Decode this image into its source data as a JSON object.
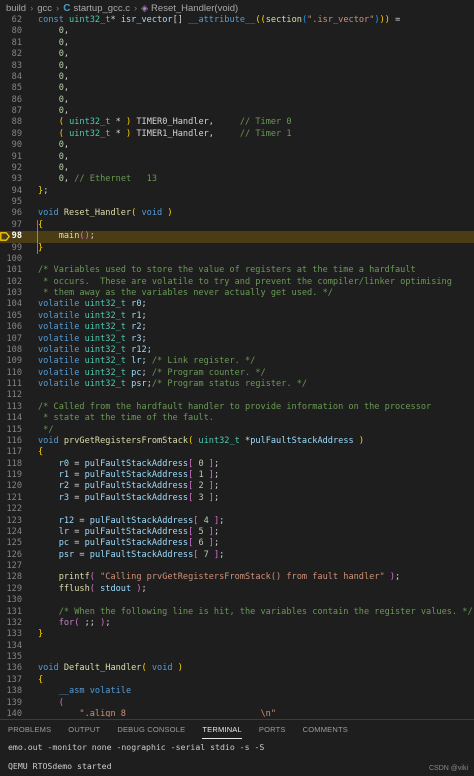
{
  "breadcrumb": {
    "items": [
      "build",
      "gcc",
      "startup_gcc.c",
      "Reset_Handler(void)"
    ]
  },
  "editor": {
    "current_line": 98,
    "lines": [
      {
        "n": "62",
        "t": [
          [
            "kw",
            "const "
          ],
          [
            "ty",
            "uint32_t"
          ],
          [
            "pl",
            "* "
          ],
          [
            "var",
            "isr_vector"
          ],
          [
            "pl",
            "[] "
          ],
          [
            "kw",
            "__attribute__"
          ],
          [
            "par",
            "(("
          ],
          [
            "fn",
            "section"
          ],
          [
            "par3",
            "("
          ],
          [
            "str",
            "\".isr_vector\""
          ],
          [
            "par3",
            ")"
          ],
          [
            "par",
            "))"
          ],
          [
            "pl",
            " ="
          ]
        ]
      },
      {
        "n": "80",
        "t": [
          [
            "pl",
            "    "
          ],
          [
            "num",
            "0"
          ],
          [
            "pl",
            ","
          ]
        ]
      },
      {
        "n": "81",
        "t": [
          [
            "pl",
            "    "
          ],
          [
            "num",
            "0"
          ],
          [
            "pl",
            ","
          ]
        ]
      },
      {
        "n": "82",
        "t": [
          [
            "pl",
            "    "
          ],
          [
            "num",
            "0"
          ],
          [
            "pl",
            ","
          ]
        ]
      },
      {
        "n": "83",
        "t": [
          [
            "pl",
            "    "
          ],
          [
            "num",
            "0"
          ],
          [
            "pl",
            ","
          ]
        ]
      },
      {
        "n": "84",
        "t": [
          [
            "pl",
            "    "
          ],
          [
            "num",
            "0"
          ],
          [
            "pl",
            ","
          ]
        ]
      },
      {
        "n": "85",
        "t": [
          [
            "pl",
            "    "
          ],
          [
            "num",
            "0"
          ],
          [
            "pl",
            ","
          ]
        ]
      },
      {
        "n": "86",
        "t": [
          [
            "pl",
            "    "
          ],
          [
            "num",
            "0"
          ],
          [
            "pl",
            ","
          ]
        ]
      },
      {
        "n": "87",
        "t": [
          [
            "pl",
            "    "
          ],
          [
            "num",
            "0"
          ],
          [
            "pl",
            ","
          ]
        ]
      },
      {
        "n": "88",
        "t": [
          [
            "pl",
            "    "
          ],
          [
            "par",
            "( "
          ],
          [
            "ty",
            "uint32_t"
          ],
          [
            "pl",
            " * "
          ],
          [
            "par",
            ")"
          ],
          [
            "pl",
            " TIMER0_Handler,     "
          ],
          [
            "com",
            "// Timer 0"
          ]
        ]
      },
      {
        "n": "89",
        "t": [
          [
            "pl",
            "    "
          ],
          [
            "par",
            "( "
          ],
          [
            "ty",
            "uint32_t"
          ],
          [
            "pl",
            " * "
          ],
          [
            "par",
            ")"
          ],
          [
            "pl",
            " TIMER1_Handler,     "
          ],
          [
            "com",
            "// Timer 1"
          ]
        ]
      },
      {
        "n": "90",
        "t": [
          [
            "pl",
            "    "
          ],
          [
            "num",
            "0"
          ],
          [
            "pl",
            ","
          ]
        ]
      },
      {
        "n": "91",
        "t": [
          [
            "pl",
            "    "
          ],
          [
            "num",
            "0"
          ],
          [
            "pl",
            ","
          ]
        ]
      },
      {
        "n": "92",
        "t": [
          [
            "pl",
            "    "
          ],
          [
            "num",
            "0"
          ],
          [
            "pl",
            ","
          ]
        ]
      },
      {
        "n": "93",
        "t": [
          [
            "pl",
            "    "
          ],
          [
            "num",
            "0"
          ],
          [
            "pl",
            ", "
          ],
          [
            "com",
            "// Ethernet   13"
          ]
        ]
      },
      {
        "n": "94",
        "t": [
          [
            "par",
            "}"
          ],
          [
            "pl",
            ";"
          ]
        ]
      },
      {
        "n": "95",
        "t": []
      },
      {
        "n": "96",
        "t": [
          [
            "kw",
            "void "
          ],
          [
            "fn",
            "Reset_Handler"
          ],
          [
            "par",
            "( "
          ],
          [
            "kw",
            "void"
          ],
          [
            "par",
            " )"
          ]
        ]
      },
      {
        "n": "97",
        "t": [
          [
            "par",
            "{"
          ]
        ]
      },
      {
        "n": "98",
        "t": [
          [
            "pl",
            "    "
          ],
          [
            "fn",
            "main"
          ],
          [
            "par2",
            "()"
          ],
          [
            "pl",
            ";"
          ]
        ]
      },
      {
        "n": "99",
        "t": [
          [
            "par",
            "}"
          ]
        ]
      },
      {
        "n": "100",
        "t": []
      },
      {
        "n": "101",
        "t": [
          [
            "com",
            "/* Variables used to store the value of registers at the time a hardfault"
          ]
        ]
      },
      {
        "n": "102",
        "t": [
          [
            "com",
            " * occurs.  These are volatile to try and prevent the compiler/linker optimising"
          ]
        ]
      },
      {
        "n": "103",
        "t": [
          [
            "com",
            " * them away as the variables never actually get used. */"
          ]
        ]
      },
      {
        "n": "104",
        "t": [
          [
            "kw",
            "volatile "
          ],
          [
            "ty",
            "uint32_t"
          ],
          [
            "var",
            " r0"
          ],
          [
            "pl",
            ";"
          ]
        ]
      },
      {
        "n": "105",
        "t": [
          [
            "kw",
            "volatile "
          ],
          [
            "ty",
            "uint32_t"
          ],
          [
            "var",
            " r1"
          ],
          [
            "pl",
            ";"
          ]
        ]
      },
      {
        "n": "106",
        "t": [
          [
            "kw",
            "volatile "
          ],
          [
            "ty",
            "uint32_t"
          ],
          [
            "var",
            " r2"
          ],
          [
            "pl",
            ";"
          ]
        ]
      },
      {
        "n": "107",
        "t": [
          [
            "kw",
            "volatile "
          ],
          [
            "ty",
            "uint32_t"
          ],
          [
            "var",
            " r3"
          ],
          [
            "pl",
            ";"
          ]
        ]
      },
      {
        "n": "108",
        "t": [
          [
            "kw",
            "volatile "
          ],
          [
            "ty",
            "uint32_t"
          ],
          [
            "var",
            " r12"
          ],
          [
            "pl",
            ";"
          ]
        ]
      },
      {
        "n": "109",
        "t": [
          [
            "kw",
            "volatile "
          ],
          [
            "ty",
            "uint32_t"
          ],
          [
            "var",
            " lr"
          ],
          [
            "pl",
            "; "
          ],
          [
            "com",
            "/* Link register. */"
          ]
        ]
      },
      {
        "n": "110",
        "t": [
          [
            "kw",
            "volatile "
          ],
          [
            "ty",
            "uint32_t"
          ],
          [
            "var",
            " pc"
          ],
          [
            "pl",
            "; "
          ],
          [
            "com",
            "/* Program counter. */"
          ]
        ]
      },
      {
        "n": "111",
        "t": [
          [
            "kw",
            "volatile "
          ],
          [
            "ty",
            "uint32_t"
          ],
          [
            "var",
            " psr"
          ],
          [
            "pl",
            ";"
          ],
          [
            "com",
            "/* Program status register. */"
          ]
        ]
      },
      {
        "n": "112",
        "t": []
      },
      {
        "n": "113",
        "t": [
          [
            "com",
            "/* Called from the hardfault handler to provide information on the processor"
          ]
        ]
      },
      {
        "n": "114",
        "t": [
          [
            "com",
            " * state at the time of the fault."
          ]
        ]
      },
      {
        "n": "115",
        "t": [
          [
            "com",
            " */"
          ]
        ]
      },
      {
        "n": "116",
        "t": [
          [
            "kw",
            "void "
          ],
          [
            "fn",
            "prvGetRegistersFromStack"
          ],
          [
            "par",
            "( "
          ],
          [
            "ty",
            "uint32_t"
          ],
          [
            "pl",
            " *"
          ],
          [
            "var",
            "pulFaultStackAddress"
          ],
          [
            "par",
            " )"
          ]
        ]
      },
      {
        "n": "117",
        "t": [
          [
            "par",
            "{"
          ]
        ]
      },
      {
        "n": "118",
        "t": [
          [
            "pl",
            "    "
          ],
          [
            "var",
            "r0"
          ],
          [
            "pl",
            " = "
          ],
          [
            "var",
            "pulFaultStackAddress"
          ],
          [
            "par2",
            "[ "
          ],
          [
            "num",
            "0"
          ],
          [
            "par2",
            " ]"
          ],
          [
            "pl",
            ";"
          ]
        ]
      },
      {
        "n": "119",
        "t": [
          [
            "pl",
            "    "
          ],
          [
            "var",
            "r1"
          ],
          [
            "pl",
            " = "
          ],
          [
            "var",
            "pulFaultStackAddress"
          ],
          [
            "par2",
            "[ "
          ],
          [
            "num",
            "1"
          ],
          [
            "par2",
            " ]"
          ],
          [
            "pl",
            ";"
          ]
        ]
      },
      {
        "n": "120",
        "t": [
          [
            "pl",
            "    "
          ],
          [
            "var",
            "r2"
          ],
          [
            "pl",
            " = "
          ],
          [
            "var",
            "pulFaultStackAddress"
          ],
          [
            "par2",
            "[ "
          ],
          [
            "num",
            "2"
          ],
          [
            "par2",
            " ]"
          ],
          [
            "pl",
            ";"
          ]
        ]
      },
      {
        "n": "121",
        "t": [
          [
            "pl",
            "    "
          ],
          [
            "var",
            "r3"
          ],
          [
            "pl",
            " = "
          ],
          [
            "var",
            "pulFaultStackAddress"
          ],
          [
            "par2",
            "[ "
          ],
          [
            "num",
            "3"
          ],
          [
            "par2",
            " ]"
          ],
          [
            "pl",
            ";"
          ]
        ]
      },
      {
        "n": "122",
        "t": []
      },
      {
        "n": "123",
        "t": [
          [
            "pl",
            "    "
          ],
          [
            "var",
            "r12"
          ],
          [
            "pl",
            " = "
          ],
          [
            "var",
            "pulFaultStackAddress"
          ],
          [
            "par2",
            "[ "
          ],
          [
            "num",
            "4"
          ],
          [
            "par2",
            " ]"
          ],
          [
            "pl",
            ";"
          ]
        ]
      },
      {
        "n": "124",
        "t": [
          [
            "pl",
            "    "
          ],
          [
            "var",
            "lr"
          ],
          [
            "pl",
            " = "
          ],
          [
            "var",
            "pulFaultStackAddress"
          ],
          [
            "par2",
            "[ "
          ],
          [
            "num",
            "5"
          ],
          [
            "par2",
            " ]"
          ],
          [
            "pl",
            ";"
          ]
        ]
      },
      {
        "n": "125",
        "t": [
          [
            "pl",
            "    "
          ],
          [
            "var",
            "pc"
          ],
          [
            "pl",
            " = "
          ],
          [
            "var",
            "pulFaultStackAddress"
          ],
          [
            "par2",
            "[ "
          ],
          [
            "num",
            "6"
          ],
          [
            "par2",
            " ]"
          ],
          [
            "pl",
            ";"
          ]
        ]
      },
      {
        "n": "126",
        "t": [
          [
            "pl",
            "    "
          ],
          [
            "var",
            "psr"
          ],
          [
            "pl",
            " = "
          ],
          [
            "var",
            "pulFaultStackAddress"
          ],
          [
            "par2",
            "[ "
          ],
          [
            "num",
            "7"
          ],
          [
            "par2",
            " ]"
          ],
          [
            "pl",
            ";"
          ]
        ]
      },
      {
        "n": "127",
        "t": []
      },
      {
        "n": "128",
        "t": [
          [
            "pl",
            "    "
          ],
          [
            "fn",
            "printf"
          ],
          [
            "par2",
            "( "
          ],
          [
            "str",
            "\"Calling prvGetRegistersFromStack() from fault handler\""
          ],
          [
            "par2",
            " )"
          ],
          [
            "pl",
            ";"
          ]
        ]
      },
      {
        "n": "129",
        "t": [
          [
            "pl",
            "    "
          ],
          [
            "fn",
            "fflush"
          ],
          [
            "par2",
            "( "
          ],
          [
            "var",
            "stdout"
          ],
          [
            "par2",
            " )"
          ],
          [
            "pl",
            ";"
          ]
        ]
      },
      {
        "n": "130",
        "t": []
      },
      {
        "n": "131",
        "t": [
          [
            "pl",
            "    "
          ],
          [
            "com",
            "/* When the following line is hit, the variables contain the register values. */"
          ]
        ]
      },
      {
        "n": "132",
        "t": [
          [
            "pl",
            "    "
          ],
          [
            "ctl",
            "for"
          ],
          [
            "par2",
            "( "
          ],
          [
            "pl",
            ";; "
          ],
          [
            "par2",
            ")"
          ],
          [
            "pl",
            ";"
          ]
        ]
      },
      {
        "n": "133",
        "t": [
          [
            "par",
            "}"
          ]
        ]
      },
      {
        "n": "134",
        "t": []
      },
      {
        "n": "135",
        "t": []
      },
      {
        "n": "136",
        "t": [
          [
            "kw",
            "void "
          ],
          [
            "fn",
            "Default_Handler"
          ],
          [
            "par",
            "( "
          ],
          [
            "kw",
            "void"
          ],
          [
            "par",
            " )"
          ]
        ]
      },
      {
        "n": "137",
        "t": [
          [
            "par",
            "{"
          ]
        ]
      },
      {
        "n": "138",
        "t": [
          [
            "pl",
            "    "
          ],
          [
            "kw",
            "__asm volatile"
          ]
        ]
      },
      {
        "n": "139",
        "t": [
          [
            "pl",
            "    "
          ],
          [
            "par2",
            "("
          ]
        ]
      },
      {
        "n": "140",
        "t": [
          [
            "pl",
            "        "
          ],
          [
            "str",
            "\".align 8                          \\n\""
          ]
        ]
      }
    ]
  },
  "panel": {
    "tabs": [
      "PROBLEMS",
      "OUTPUT",
      "DEBUG CONSOLE",
      "TERMINAL",
      "PORTS",
      "COMMENTS"
    ],
    "active_tab": "TERMINAL"
  },
  "terminal": {
    "lines": [
      "emo.out -monitor none -nographic -serial stdio -s -S",
      "QEMU RTOSdemo started"
    ]
  },
  "watermark": "CSDN @viki"
}
